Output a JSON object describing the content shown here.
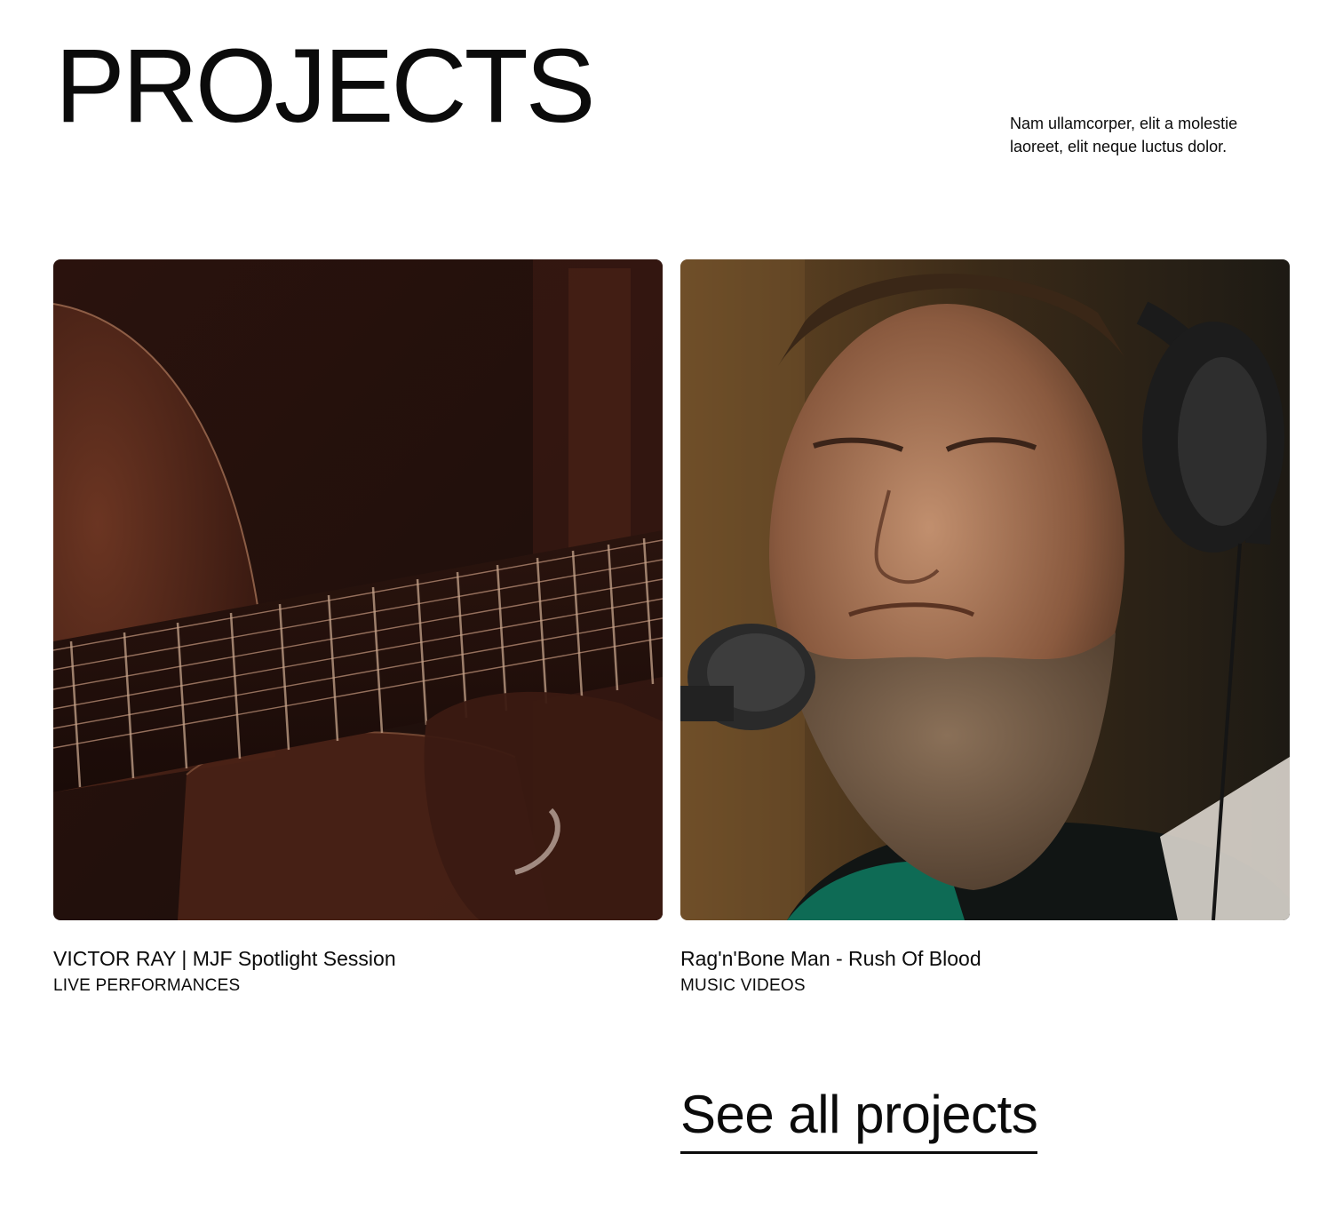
{
  "header": {
    "title": "PROJECTS",
    "intro": "Nam ullamcorper, elit a molestie laoreet, elit neque luctus dolor."
  },
  "projects": [
    {
      "title": "VICTOR RAY | MJF Spotlight Session",
      "category": "LIVE PERFORMANCES"
    },
    {
      "title": "Rag'n'Bone Man - Rush Of Blood",
      "category": "MUSIC VIDEOS"
    }
  ],
  "cta": {
    "label": "See all projects"
  },
  "colors": {
    "text": "#0b0b0b",
    "background": "#ffffff"
  }
}
